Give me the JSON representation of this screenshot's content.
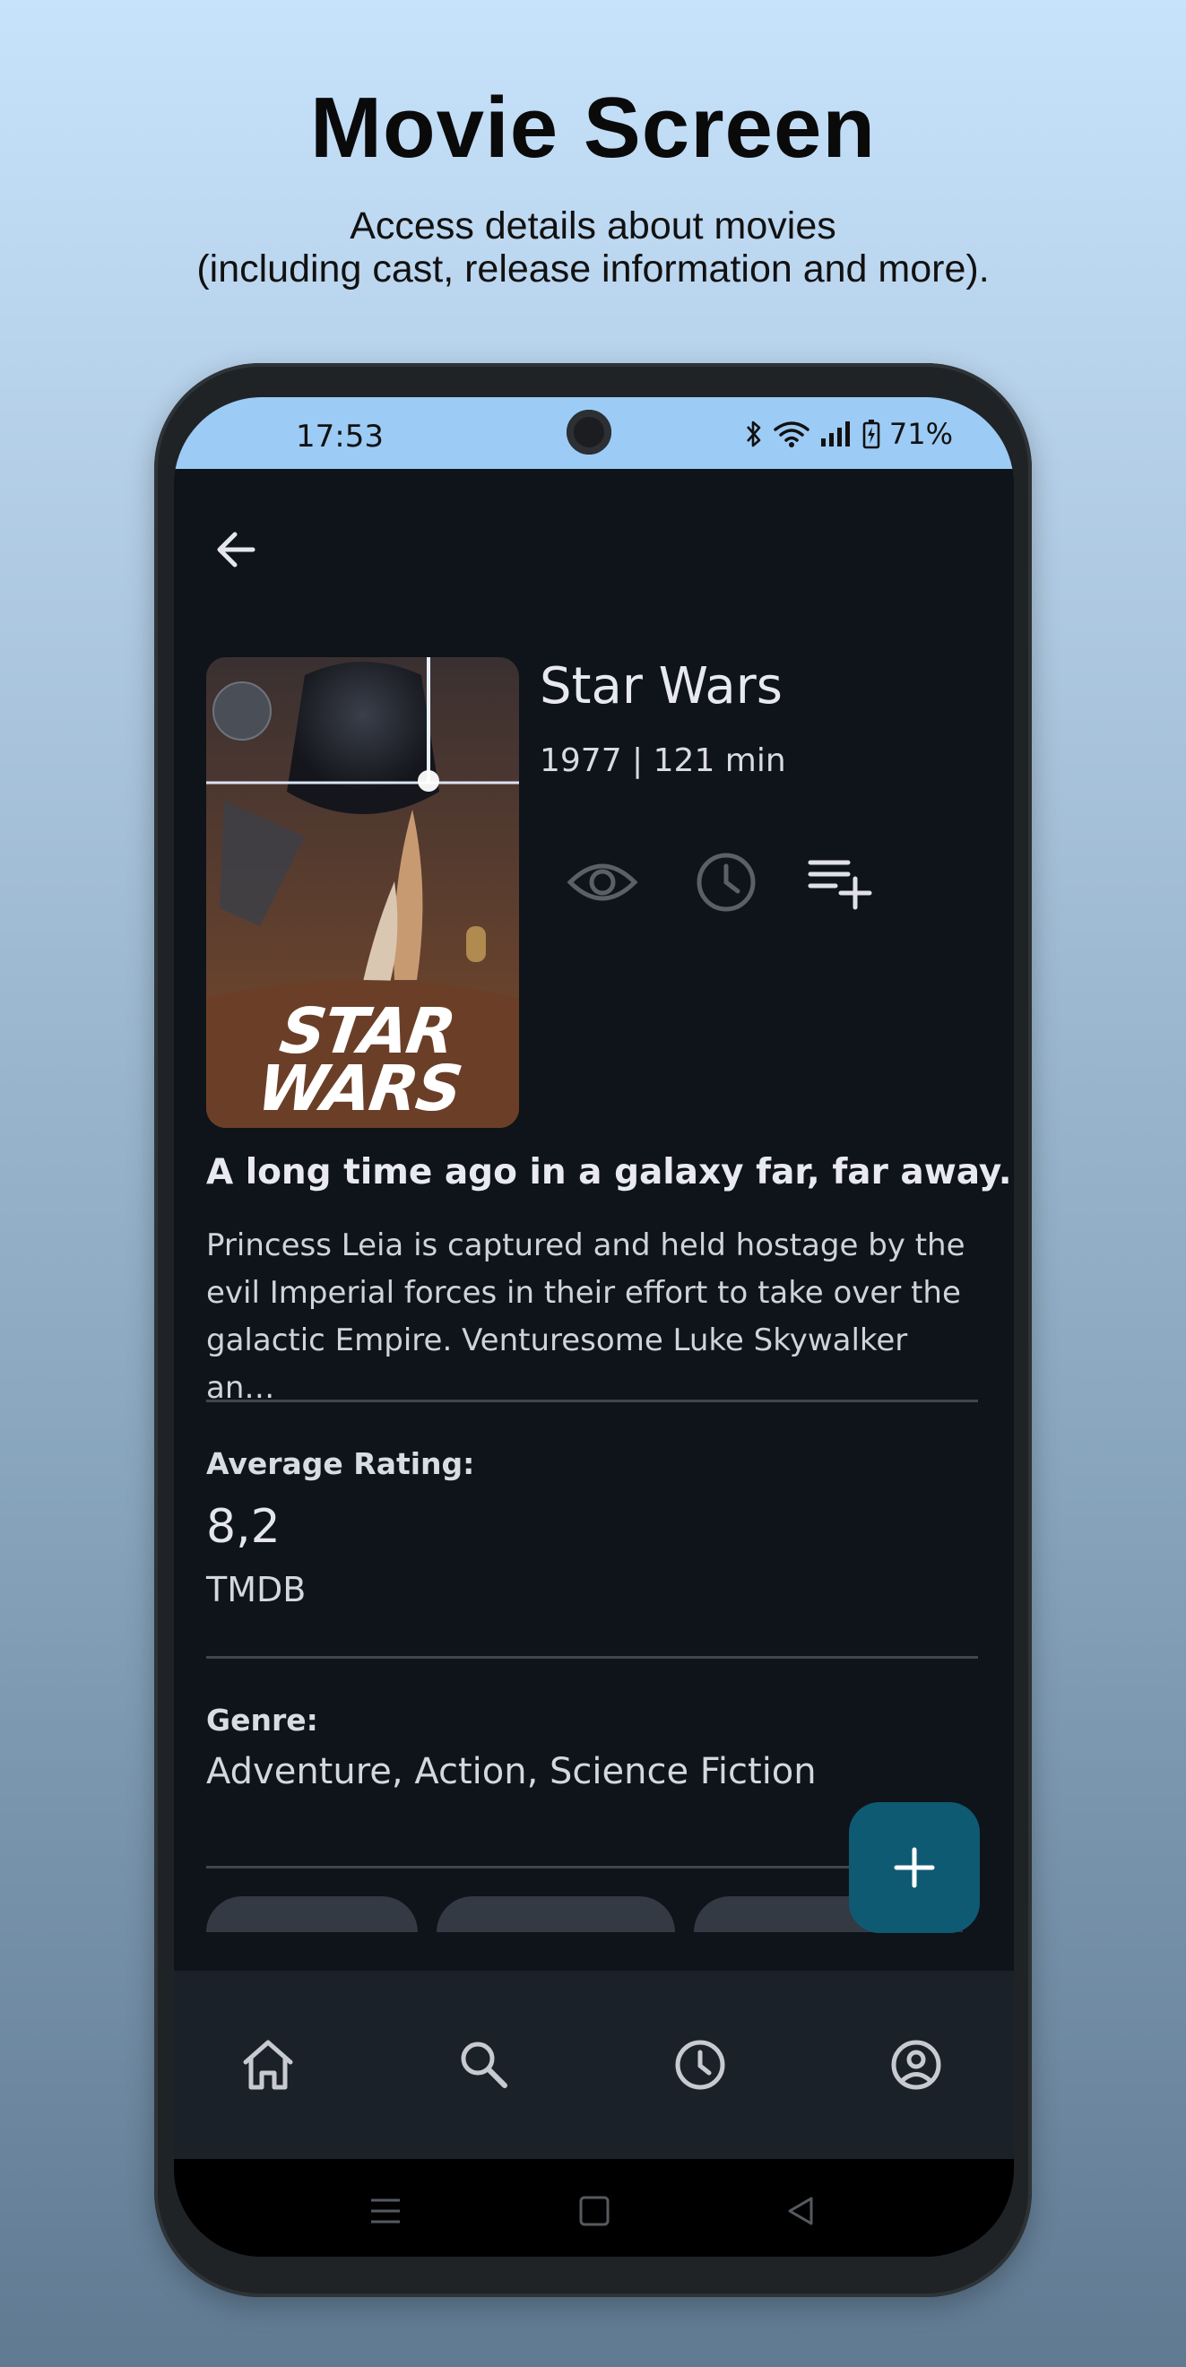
{
  "promo": {
    "title": "Movie Screen",
    "subtitle_line1": "Access details about movies",
    "subtitle_line2": "(including cast, release information and more)."
  },
  "status_bar": {
    "time": "17:53",
    "battery": "71%",
    "icons": [
      "bluetooth-icon",
      "wifi-icon",
      "signal-icon",
      "battery-icon"
    ]
  },
  "movie": {
    "title": "Star Wars",
    "meta": "1977 | 121 min",
    "poster_text_line1": "STAR",
    "poster_text_line2": "WARS",
    "tagline": "A long time ago in a galaxy far, far away...",
    "overview_line1": "Princess Leia is captured and held hostage by the",
    "overview_line2": "evil Imperial forces in their effort to take over the",
    "overview_line3": "galactic Empire. Venturesome Luke Skywalker an…"
  },
  "actions": [
    "eye-icon",
    "clock-icon",
    "playlist-add-icon"
  ],
  "rating": {
    "label": "Average Rating:",
    "value": "8,2",
    "source": "TMDB"
  },
  "genre": {
    "label": "Genre:",
    "value": "Adventure, Action, Science Fiction"
  },
  "fab": {
    "symbol": "+"
  },
  "bottom_nav": [
    "home-icon",
    "search-icon",
    "history-icon",
    "account-icon"
  ],
  "colors": {
    "status_bar": "#9ccbf5",
    "screen_bg": "#0f131a",
    "fab": "#0f5a73",
    "bottom_nav": "#1b2128"
  }
}
